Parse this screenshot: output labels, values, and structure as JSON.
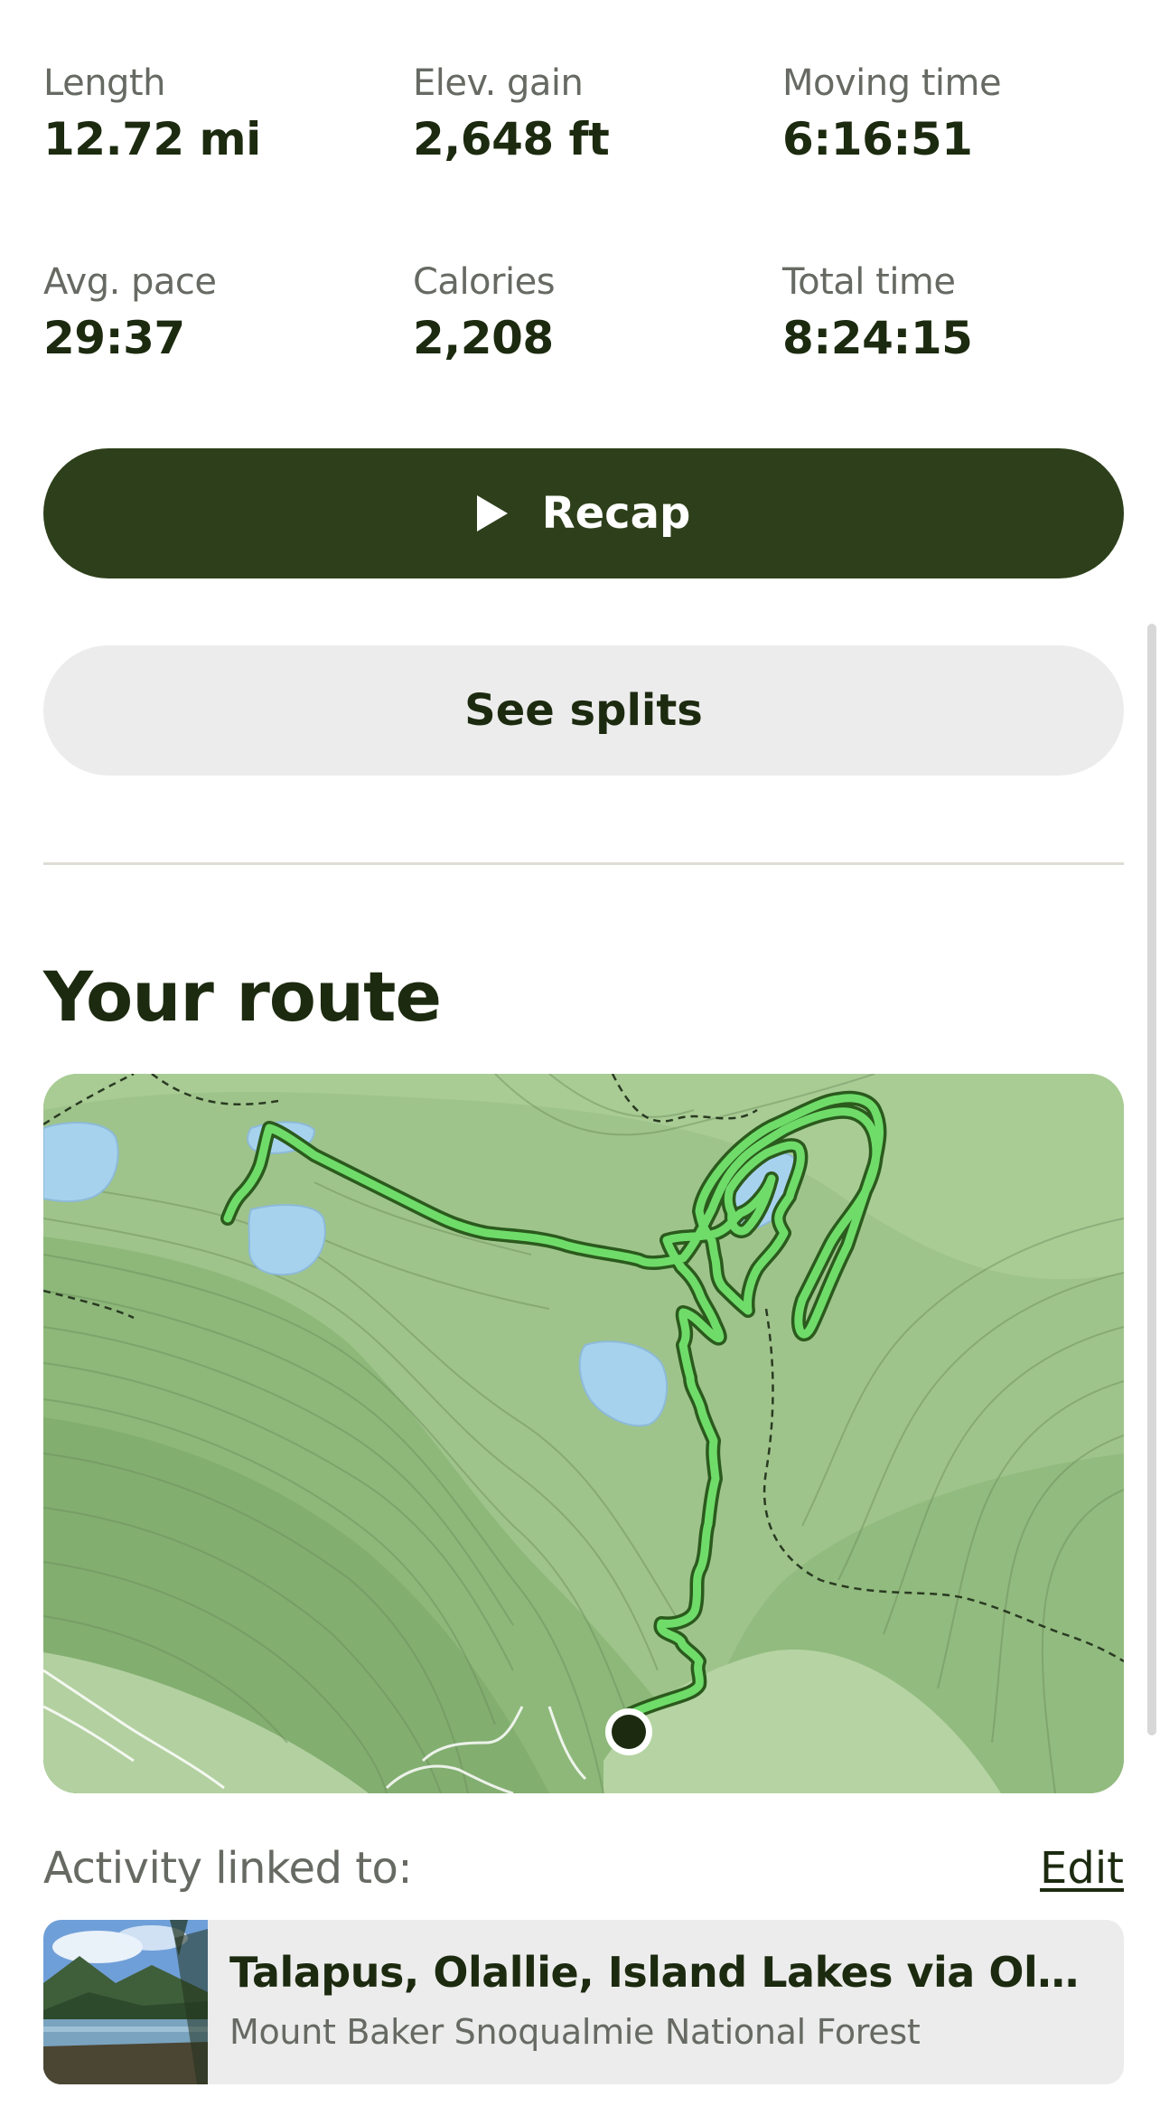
{
  "stats": [
    {
      "label": "Length",
      "value": "12.72 mi"
    },
    {
      "label": "Elev. gain",
      "value": "2,648 ft"
    },
    {
      "label": "Moving time",
      "value": "6:16:51"
    },
    {
      "label": "Avg. pace",
      "value": "29:37"
    },
    {
      "label": "Calories",
      "value": "2,208"
    },
    {
      "label": "Total time",
      "value": "8:24:15"
    }
  ],
  "buttons": {
    "recap_label": "Recap",
    "recap_icon": "play-icon",
    "splits_label": "See splits"
  },
  "route": {
    "title": "Your route"
  },
  "linked": {
    "label": "Activity linked to:",
    "edit_label": "Edit"
  },
  "trail": {
    "title": "Talapus, Olallie, Island Lakes via Olallie Lake Trail",
    "subtitle": "Mount Baker Snoqualmie National Forest"
  },
  "colors": {
    "primary": "#2e401b",
    "route_line": "#6fdc6a",
    "secondary_button": "#ececec",
    "text_dark": "#1c2a0f",
    "text_muted": "#666a63"
  }
}
